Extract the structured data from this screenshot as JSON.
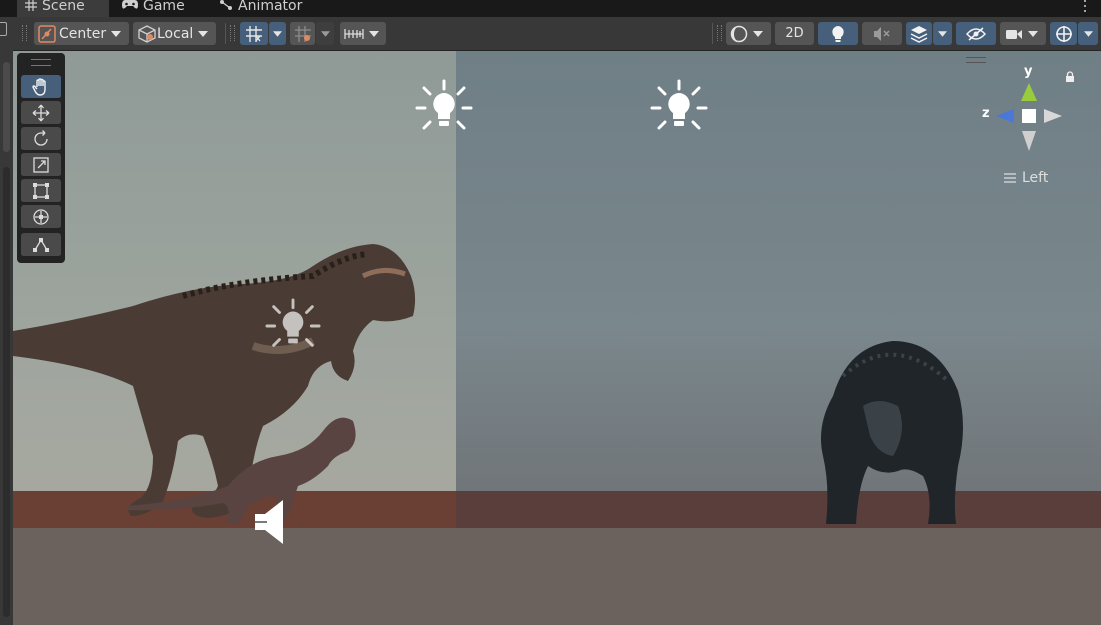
{
  "tabs": [
    {
      "label": "Scene",
      "icon": "grid-icon"
    },
    {
      "label": "Game",
      "icon": "gamepad-icon"
    },
    {
      "label": "Animator",
      "icon": "animator-icon"
    }
  ],
  "toolbar": {
    "pivot_label": "Center",
    "space_label": "Local",
    "mode_2d_label": "2D"
  },
  "gizmo": {
    "y_label": "y",
    "z_label": "z",
    "view_label": "Left"
  },
  "colors": {
    "accent": "#46607c",
    "toolbar": "#383838",
    "button": "#555555"
  }
}
